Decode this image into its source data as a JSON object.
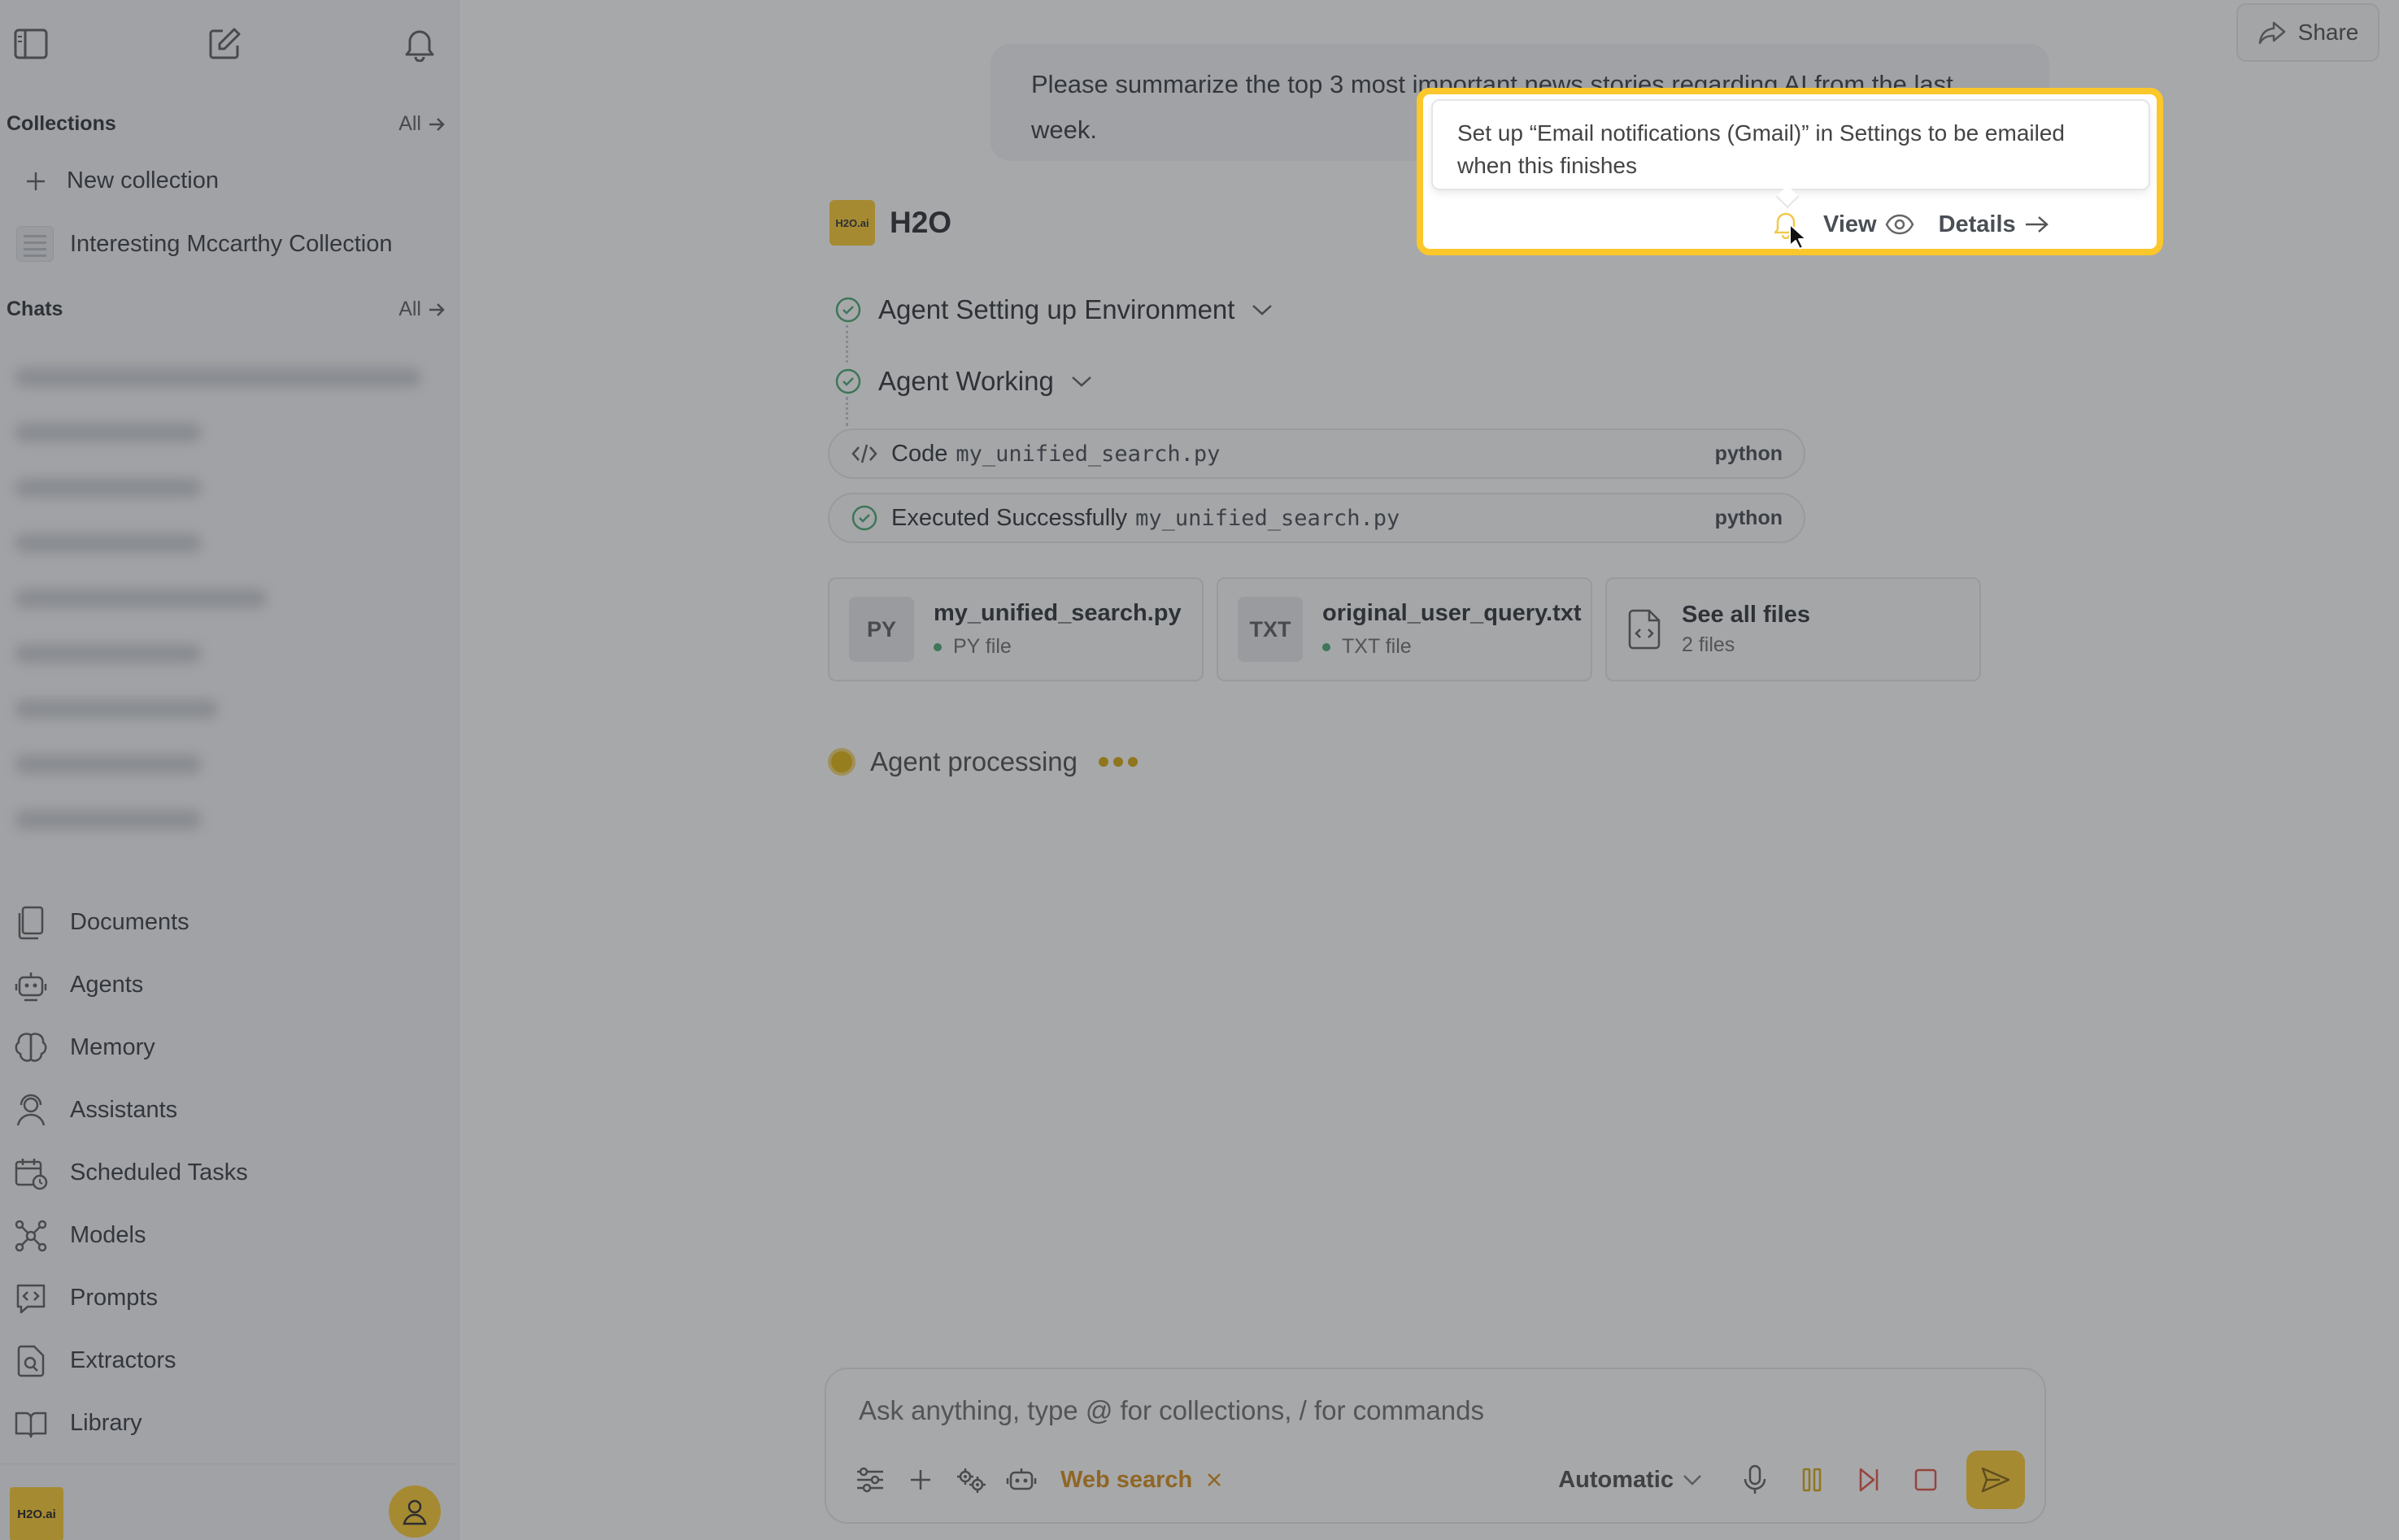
{
  "sidebar": {
    "collections_title": "Collections",
    "collections_all": "All",
    "new_collection": "New collection",
    "collection_item": "Interesting Mccarthy Collection",
    "chats_title": "Chats",
    "chats_all": "All",
    "nav": [
      {
        "label": "Documents",
        "icon": "documents-icon"
      },
      {
        "label": "Agents",
        "icon": "robot-icon"
      },
      {
        "label": "Memory",
        "icon": "brain-icon"
      },
      {
        "label": "Assistants",
        "icon": "assistant-icon"
      },
      {
        "label": "Scheduled Tasks",
        "icon": "calendar-clock-icon"
      },
      {
        "label": "Models",
        "icon": "network-icon"
      },
      {
        "label": "Prompts",
        "icon": "prompt-icon"
      },
      {
        "label": "Extractors",
        "icon": "file-search-icon"
      },
      {
        "label": "Library",
        "icon": "book-icon"
      }
    ],
    "logo_text": "H2O.ai"
  },
  "header": {
    "share_label": "Share"
  },
  "conversation": {
    "user_message": "Please summarize the top 3 most important news stories regarding AI from the last week.",
    "agent_logo_text": "H2O.ai",
    "agent_name": "H2O",
    "steps": [
      {
        "label": "Agent Setting up Environment"
      },
      {
        "label": "Agent Working"
      }
    ],
    "code_rows": [
      {
        "label": "Code",
        "file": "my_unified_search.py",
        "lang": "python"
      },
      {
        "label": "Executed Successfully",
        "file": "my_unified_search.py",
        "lang": "python"
      }
    ],
    "files": [
      {
        "badge": "PY",
        "name": "my_unified_search.py",
        "type": "PY file"
      },
      {
        "badge": "TXT",
        "name": "original_user_query.txt",
        "type": "TXT file"
      }
    ],
    "see_all": {
      "title": "See all files",
      "count": "2 files"
    },
    "processing": "Agent processing"
  },
  "composer": {
    "placeholder": "Ask anything, type @ for collections, / for commands",
    "web_search": "Web search",
    "model": "Automatic"
  },
  "spotlight": {
    "tooltip": "Set up “Email notifications (Gmail)” in Settings to be emailed when this finishes",
    "view_label": "View",
    "details_label": "Details"
  },
  "colors": {
    "accent": "#fec925",
    "spotlight_border": "#fcc72b",
    "web_search": "#d4880d",
    "success": "#3ea56b"
  }
}
